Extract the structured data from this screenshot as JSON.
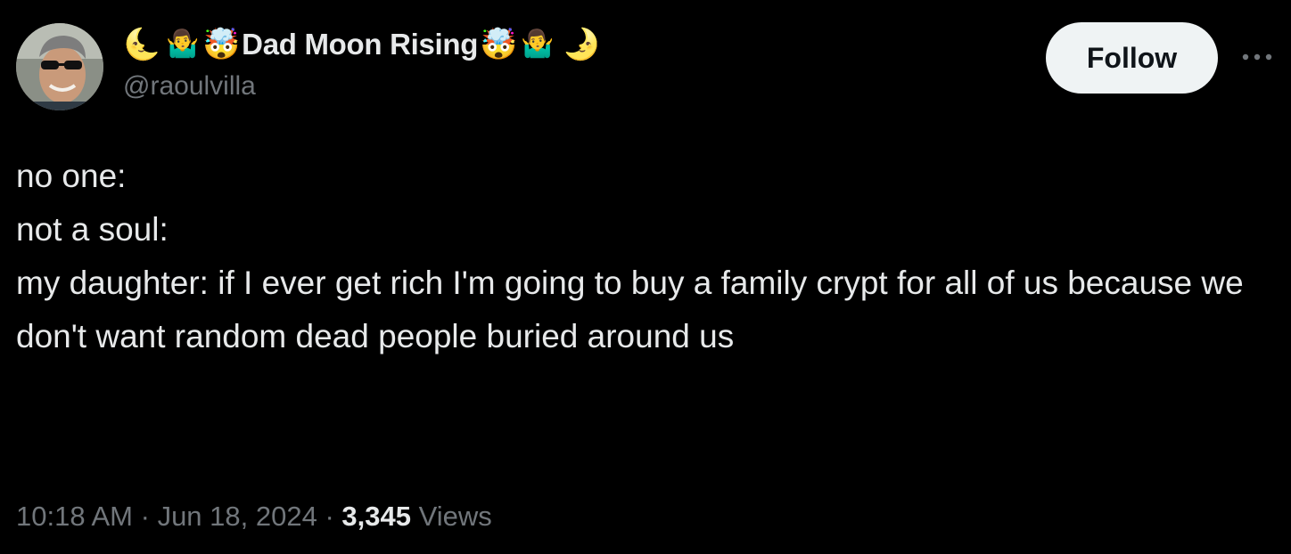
{
  "author": {
    "display_name_prefix_emojis": [
      "🌜",
      "🤷‍♂️",
      "🤯"
    ],
    "display_name": "Dad Moon Rising",
    "display_name_suffix_emojis": [
      "🤯",
      "🤷‍♂️",
      "🌛"
    ],
    "handle": "@raoulvilla"
  },
  "actions": {
    "follow_label": "Follow",
    "more_icon": "more-horizontal-icon"
  },
  "tweet": {
    "lines": [
      "no one:",
      "",
      "not a soul:",
      "",
      "my daughter: if I ever get rich I'm going to buy a family crypt for all of us because we don't want random dead people buried around us"
    ]
  },
  "meta": {
    "time": "10:18 AM",
    "separator": "·",
    "date": "Jun 18, 2024",
    "views_count": "3,345",
    "views_label": "Views"
  },
  "colors": {
    "background": "#000000",
    "primary_text": "#e7e9ea",
    "secondary_text": "#71767b",
    "follow_bg": "#eff3f4",
    "follow_text": "#0f1419"
  }
}
